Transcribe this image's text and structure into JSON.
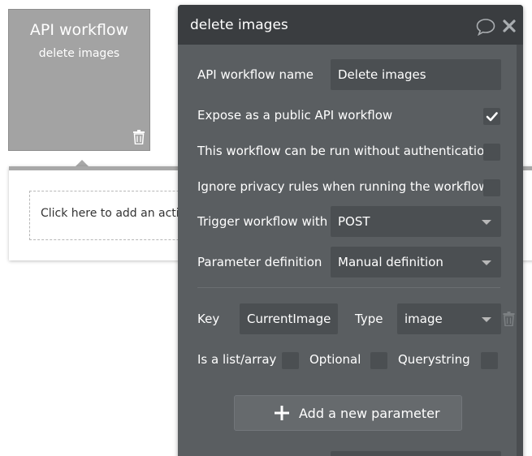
{
  "canvas": {
    "workflow_card": {
      "title": "API workflow",
      "subtitle": "delete images"
    },
    "add_action_text": "Click here to add an action"
  },
  "panel": {
    "title": "delete images",
    "fields": {
      "name_label": "API workflow name",
      "name_value": "Delete images",
      "expose_label": "Expose as a public API workflow",
      "expose_checked": true,
      "no_auth_label": "This workflow can be run without authentication",
      "no_auth_checked": false,
      "ignore_privacy_label": "Ignore privacy rules when running the workflow",
      "ignore_privacy_checked": false,
      "trigger_label": "Trigger workflow with",
      "trigger_value": "POST",
      "param_def_label": "Parameter definition",
      "param_def_value": "Manual definition"
    },
    "parameter": {
      "key_label": "Key",
      "key_value": "CurrentImage",
      "type_label": "Type",
      "type_value": "image",
      "list_label": "Is a list/array",
      "optional_label": "Optional",
      "querystring_label": "Querystring"
    },
    "add_parameter_label": "Add a new parameter"
  },
  "colors": {
    "panel_bg": "#5a5e61",
    "header_bg": "#3a3d40",
    "field_bg": "#4b4f52",
    "card_bg": "#a3a3a3"
  },
  "icons": [
    "trash-icon",
    "comment-icon",
    "close-icon",
    "checkmark-icon",
    "chevron-down-icon",
    "plus-icon"
  ]
}
